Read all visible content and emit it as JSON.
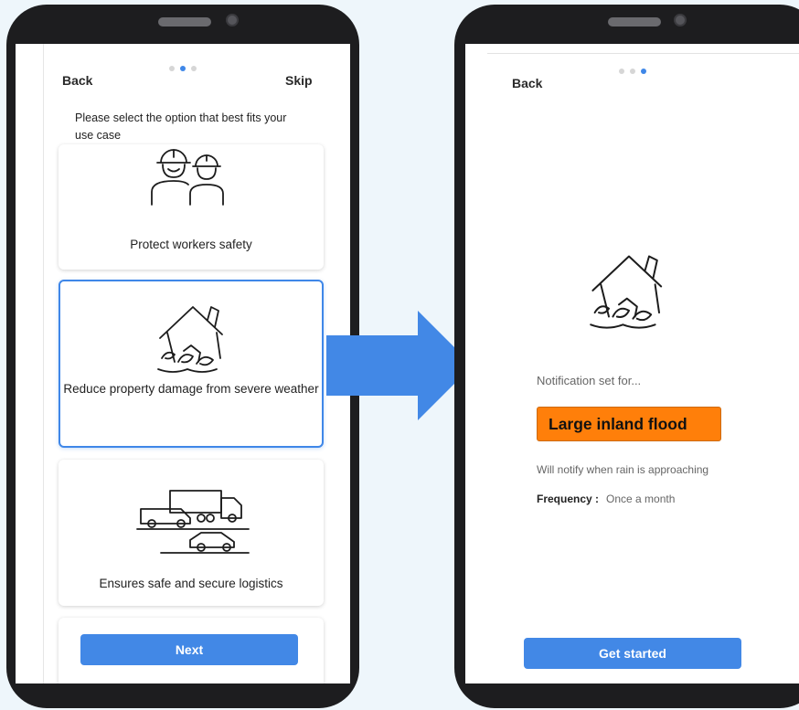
{
  "onboarding": {
    "back_label": "Back",
    "skip_label": "Skip",
    "instruction": "Please select the option that best fits your use case",
    "options": [
      {
        "label": "Protect workers safety",
        "icon": "workers-icon",
        "selected": false
      },
      {
        "label": "Reduce property damage from severe weather",
        "icon": "flooded-house-icon",
        "selected": true
      },
      {
        "label": "Ensures safe and secure logistics",
        "icon": "logistics-vehicles-icon",
        "selected": false
      }
    ],
    "next_label": "Next",
    "page_dots": {
      "total": 3,
      "active_index": 1
    }
  },
  "confirmation": {
    "back_label": "Back",
    "notification_label": "Notification set for...",
    "event_name": "Large inland flood",
    "notify_text": "Will notify when rain is approaching",
    "frequency_label": "Frequency :",
    "frequency_value": "Once a month",
    "get_started_label": "Get started",
    "page_dots": {
      "total": 3,
      "active_index": 2
    }
  },
  "colors": {
    "accent": "#4288e6",
    "alert": "#ff7f0a",
    "background": "#eef6fb",
    "phone_frame": "#1d1d1f"
  }
}
